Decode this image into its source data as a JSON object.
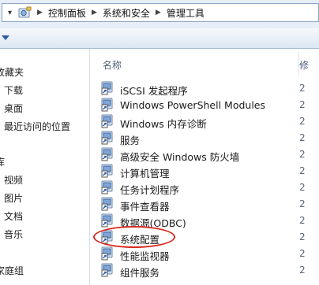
{
  "address_bar": {
    "breadcrumbs": [
      "控制面板",
      "系统和安全",
      "管理工具"
    ],
    "separator": "▶"
  },
  "nav": {
    "favorites_header": "收藏夹",
    "favorites": [
      "下载",
      "桌面",
      "最近访问的位置"
    ],
    "libraries_header": "库",
    "libraries": [
      "视频",
      "图片",
      "文档",
      "音乐"
    ],
    "homegroup": "家庭组"
  },
  "list": {
    "col_name": "名称",
    "col_modified": "修",
    "items": [
      {
        "label": "iSCSI 发起程序",
        "date": "2"
      },
      {
        "label": "Windows PowerShell Modules",
        "date": "2"
      },
      {
        "label": "Windows 内存诊断",
        "date": "2"
      },
      {
        "label": "服务",
        "date": "2"
      },
      {
        "label": "高级安全 Windows 防火墙",
        "date": "2"
      },
      {
        "label": "计算机管理",
        "date": "2"
      },
      {
        "label": "任务计划程序",
        "date": "2"
      },
      {
        "label": "事件查看器",
        "date": "2"
      },
      {
        "label": "数据源(ODBC)",
        "date": "2"
      },
      {
        "label": "系统配置",
        "date": "2"
      },
      {
        "label": "性能监视器",
        "date": "2"
      },
      {
        "label": "组件服务",
        "date": "2"
      }
    ],
    "highlighted_item": "系统配置"
  },
  "colors": {
    "accent": "#2c5aa0",
    "highlight_ring": "#d82a20",
    "toolbar_bg": "#dde7f3"
  }
}
